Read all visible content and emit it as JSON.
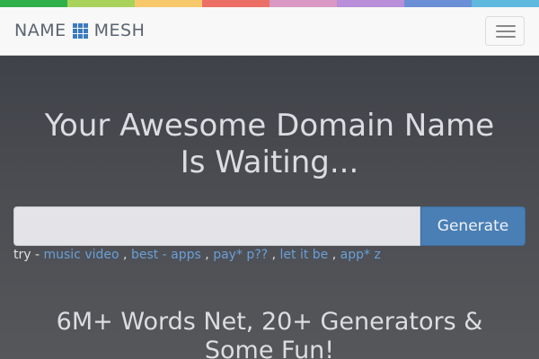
{
  "top_strip": {
    "colors": [
      "#2fb04a",
      "#a8d25c",
      "#f7c96a",
      "#ec6f66",
      "#d999c4",
      "#b88fd8",
      "#6b8fd6",
      "#5fb8de"
    ]
  },
  "navbar": {
    "brand_left": "NAME",
    "brand_right": "MESH",
    "brand_icon": "grid-icon",
    "menu_icon": "hamburger-menu-icon"
  },
  "hero": {
    "headline_line1": "Your Awesome Domain Name",
    "headline_line2": "Is Waiting...",
    "search_value": "",
    "generate_label": "Generate",
    "try_prefix": "try - ",
    "suggestions": [
      "music video",
      "best - apps",
      "pay* p??",
      "let it be",
      "app* z"
    ],
    "separator": " , ",
    "sub_headline_line1": "6M+ Words Net, 20+ Generators &",
    "sub_headline_line2": "Some Fun!"
  },
  "colors": {
    "accent": "#4a7fb5",
    "link": "#6a9fd8",
    "brand_icon": "#3b7bc0"
  }
}
